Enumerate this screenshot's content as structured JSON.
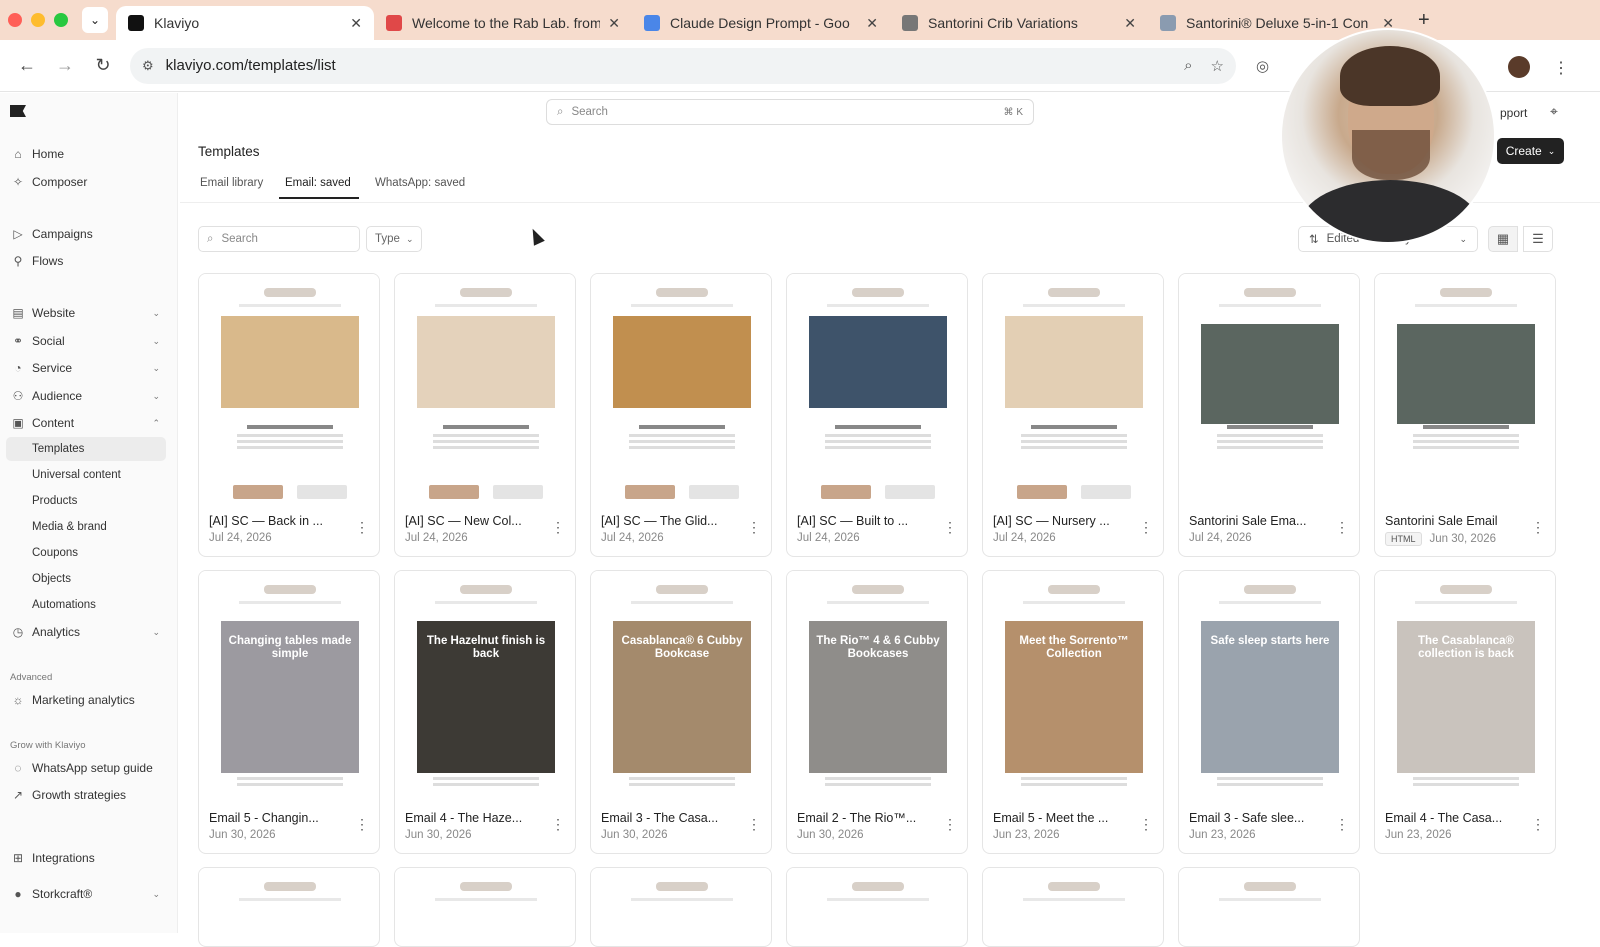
{
  "browser": {
    "tabs": [
      {
        "title": "Klaviyo",
        "active": true,
        "favicon_color": "#111111"
      },
      {
        "title": "Welcome to the Rab Lab. from",
        "active": false,
        "favicon_color": "#e04848"
      },
      {
        "title": "Claude Design Prompt - Goo",
        "active": false,
        "favicon_color": "#4a86e8"
      },
      {
        "title": "Santorini Crib Variations",
        "active": false,
        "favicon_color": "#777777"
      },
      {
        "title": "Santorini® Deluxe 5-in-1 Con",
        "active": false,
        "favicon_color": "#8a9bb0"
      }
    ],
    "url": "klaviyo.com/templates/list"
  },
  "topbar": {
    "search_placeholder": "Search",
    "search_shortcut": "⌘ K",
    "support_label": "pport",
    "create_label": "Create"
  },
  "sidebar": {
    "items": [
      {
        "label": "Home",
        "icon": "home-icon"
      },
      {
        "label": "Composer",
        "icon": "sparkle-icon"
      },
      {
        "label": "Campaigns",
        "icon": "send-icon"
      },
      {
        "label": "Flows",
        "icon": "flow-icon"
      },
      {
        "label": "Website",
        "icon": "website-icon"
      },
      {
        "label": "Social",
        "icon": "social-icon"
      },
      {
        "label": "Service",
        "icon": "service-icon"
      },
      {
        "label": "Audience",
        "icon": "audience-icon"
      },
      {
        "label": "Content",
        "icon": "content-icon"
      }
    ],
    "content_subitems": [
      "Templates",
      "Universal content",
      "Products",
      "Media & brand",
      "Coupons",
      "Objects",
      "Automations"
    ],
    "analytics_label": "Analytics",
    "advanced_heading": "Advanced",
    "marketing_analytics_label": "Marketing analytics",
    "grow_heading": "Grow with Klaviyo",
    "whatsapp_guide_label": "WhatsApp setup guide",
    "growth_label": "Growth strategies",
    "integrations_label": "Integrations",
    "account_label": "Storkcraft®"
  },
  "page": {
    "title": "Templates",
    "tabs": [
      "Email library",
      "Email: saved",
      "WhatsApp: saved"
    ],
    "active_tab": "Email: saved",
    "search_placeholder": "Search",
    "type_label": "Type",
    "sort_label": "Edited — ...ently"
  },
  "templates_row1": [
    {
      "title": "[AI] SC — Back in ...",
      "date": "Jul 24, 2026",
      "img": "#d9b98b"
    },
    {
      "title": "[AI] SC — New Col...",
      "date": "Jul 24, 2026",
      "img": "#e4d2bb"
    },
    {
      "title": "[AI] SC — The Glid...",
      "date": "Jul 24, 2026",
      "img": "#c18f4f"
    },
    {
      "title": "[AI] SC — Built to ...",
      "date": "Jul 24, 2026",
      "img": "#3e536a"
    },
    {
      "title": "[AI] SC — Nursery ...",
      "date": "Jul 24, 2026",
      "img": "#e3cfb4"
    },
    {
      "title": "Santorini Sale Ema...",
      "date": "Jul 24, 2026",
      "img": "#5b6660"
    },
    {
      "title": "Santorini Sale Email",
      "date": "Jun 30, 2026",
      "badge": "HTML",
      "img": "#5b6660"
    }
  ],
  "templates_row2": [
    {
      "title": "Email 5 - Changin...",
      "date": "Jun 30, 2026",
      "img": "#9c9aa0",
      "heading": "Changing tables made simple"
    },
    {
      "title": "Email 4 - The Haze...",
      "date": "Jun 30, 2026",
      "img": "#3d3a35",
      "heading": "The Hazelnut finish is back"
    },
    {
      "title": "Email 3 - The Casa...",
      "date": "Jun 30, 2026",
      "img": "#a48a6c",
      "heading": "Casablanca® 6 Cubby Bookcase"
    },
    {
      "title": "Email 2 - The Rio™...",
      "date": "Jun 30, 2026",
      "img": "#8f8d8a",
      "heading": "The Rio™ 4 & 6 Cubby Bookcases"
    },
    {
      "title": "Email 5 - Meet the ...",
      "date": "Jun 23, 2026",
      "img": "#b5906c",
      "heading": "Meet the Sorrento™ Collection"
    },
    {
      "title": "Email 3 - Safe slee...",
      "date": "Jun 23, 2026",
      "img": "#9aa3ad",
      "heading": "Safe sleep starts here"
    },
    {
      "title": "Email 4 - The Casa...",
      "date": "Jun 23, 2026",
      "img": "#c9c3bd",
      "heading": "The Casablanca® collection is back"
    }
  ]
}
